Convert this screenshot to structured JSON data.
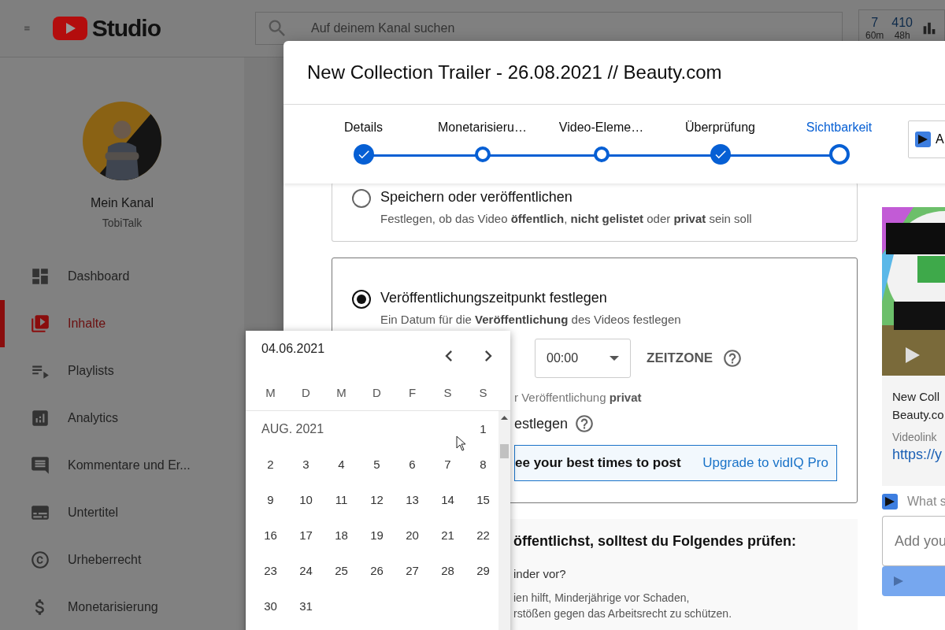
{
  "header": {
    "logo_text": "Studio",
    "search": {
      "placeholder": "Auf deinem Kanal suchen"
    },
    "stats": [
      {
        "value": "7",
        "period": "60m"
      },
      {
        "value": "410",
        "period": "48h"
      }
    ]
  },
  "sidebar": {
    "channel_title": "Mein Kanal",
    "channel_name": "TobiTalk",
    "items": [
      {
        "label": "Dashboard",
        "selected": false
      },
      {
        "label": "Inhalte",
        "selected": true
      },
      {
        "label": "Playlists",
        "selected": false
      },
      {
        "label": "Analytics",
        "selected": false
      },
      {
        "label": "Kommentare und Er...",
        "selected": false
      },
      {
        "label": "Untertitel",
        "selected": false
      },
      {
        "label": "Urheberrecht",
        "selected": false
      },
      {
        "label": "Monetarisierung",
        "selected": false
      }
    ]
  },
  "dialog": {
    "title": "New Collection Trailer - 26.08.2021 // Beauty.com",
    "steps": [
      {
        "label": "Details",
        "kind": "done",
        "selected": false
      },
      {
        "label": "Monetarisieru…",
        "kind": "todo",
        "selected": false
      },
      {
        "label": "Video-Eleme…",
        "kind": "todo",
        "selected": false
      },
      {
        "label": "Überprüfung",
        "kind": "done",
        "selected": false
      },
      {
        "label": "Sichtbarkeit",
        "kind": "current",
        "selected": true
      }
    ],
    "side_button": {
      "label": "A"
    },
    "options": [
      {
        "title": "Speichern oder veröffentlichen",
        "description": "Festlegen, ob das Video **öffentlich**, **nicht gelistet** oder **privat** sein soll",
        "selected": false
      },
      {
        "title": "Veröffentlichungszeitpunkt festlegen",
        "description": "Ein Datum für die **Veröffentlichung** des Videos festlegen",
        "selected": true
      }
    ],
    "schedule": {
      "time": "00:00",
      "timezone_label": "ZEITZONE",
      "note": "r Veröffentlichung **privat**",
      "premiere_label": "estlegen",
      "banner_text": "ee your best times to post",
      "banner_link": "Upgrade to vidIQ Pro"
    },
    "checklist": {
      "heading": "öffentlichst, solltest du Folgendes prüfen:",
      "question": "inder vor?",
      "lines": [
        "ien hilft, Minderjährige vor Schaden,",
        "rstößen gegen das Arbeitsrecht zu schützen."
      ]
    },
    "preview": {
      "title_lines": [
        "New Coll",
        "Beauty.co"
      ],
      "link_label": "Videolink",
      "link": "https://y",
      "vidiq_prompt": "What s",
      "input_placeholder": "Add you"
    }
  },
  "calendar": {
    "date": "04.06.2021",
    "weekdays": [
      "M",
      "D",
      "M",
      "D",
      "F",
      "S",
      "S"
    ],
    "month": "AUG. 2021",
    "weeks": [
      {
        "days": [
          "1"
        ],
        "kind": "trailing"
      },
      {
        "days": [
          "2",
          "3",
          "4",
          "5",
          "6",
          "7",
          "8"
        ],
        "kind": "full"
      },
      {
        "days": [
          "9",
          "10",
          "11",
          "12",
          "13",
          "14",
          "15"
        ],
        "kind": "full"
      },
      {
        "days": [
          "16",
          "17",
          "18",
          "19",
          "20",
          "21",
          "22"
        ],
        "kind": "full"
      },
      {
        "days": [
          "23",
          "24",
          "25",
          "26",
          "27",
          "28",
          "29"
        ],
        "kind": "full"
      },
      {
        "days": [
          "30",
          "31"
        ],
        "kind": "full"
      }
    ]
  }
}
